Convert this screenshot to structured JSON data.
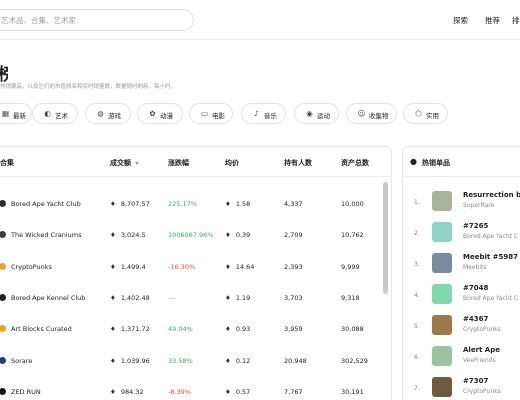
{
  "header": {
    "search_placeholder": "艺术品、合集、艺术家",
    "nav": [
      "探索",
      "推荐"
    ],
    "nav_cut": "排"
  },
  "page": {
    "title": "榜",
    "subtitle": "热销藏品，以及它们的市值排名和实时销量数，数据随时刷新，每小时。"
  },
  "filters": [
    {
      "icon": "grid-icon",
      "glyph": "▦",
      "label": "最新"
    },
    {
      "icon": "palette-icon",
      "glyph": "◐",
      "label": "艺术"
    },
    {
      "icon": "gamepad-icon",
      "glyph": "◍",
      "label": "游戏"
    },
    {
      "icon": "anime-icon",
      "glyph": "✿",
      "label": "动漫"
    },
    {
      "icon": "video-icon",
      "glyph": "▭",
      "label": "电影"
    },
    {
      "icon": "music-icon",
      "glyph": "♪",
      "label": "音乐"
    },
    {
      "icon": "sports-icon",
      "glyph": "◉",
      "label": "运动"
    },
    {
      "icon": "smile-icon",
      "glyph": "☺",
      "label": "收集物"
    },
    {
      "icon": "box-icon",
      "glyph": "⬡",
      "label": "实用"
    }
  ],
  "table": {
    "headers": [
      "合集",
      "成交额",
      "涨跌幅",
      "均价",
      "持有人数",
      "资产总数"
    ],
    "currency_symbol": "♦",
    "rows": [
      {
        "name": "Bored Ape Yacht Club",
        "avatar_color": "#2b2b2b",
        "volume": "8,707.57",
        "change": "225.17%",
        "change_color": "#3cae5d",
        "avg": "1.58",
        "holders": "4,337",
        "assets": "10,000"
      },
      {
        "name": "The Wicked Craniums",
        "avatar_color": "#3a3a3a",
        "volume": "3,024.5",
        "change": "1006067.96%",
        "change_color": "#3cae5d",
        "avg": "0.39",
        "holders": "2,709",
        "assets": "10,762"
      },
      {
        "name": "CryptoPunks",
        "avatar_color": "#e0a43a",
        "volume": "1,499.4",
        "change": "-16.30%",
        "change_color": "#e04f43",
        "avg": "14.64",
        "holders": "2,393",
        "assets": "9,999"
      },
      {
        "name": "Bored Ape Kennel Club",
        "avatar_color": "#222222",
        "volume": "1,402.48",
        "change": "---",
        "change_color": "#999999",
        "avg": "1.19",
        "holders": "3,703",
        "assets": "9,318"
      },
      {
        "name": "Art Blocks Curated",
        "avatar_color": "#f0a020",
        "volume": "1,371.72",
        "change": "49.04%",
        "change_color": "#3cae5d",
        "avg": "0.93",
        "holders": "3,959",
        "assets": "30,088"
      },
      {
        "name": "Sorare",
        "avatar_color": "#2c3b6e",
        "volume": "1,039.96",
        "change": "33.58%",
        "change_color": "#3cae5d",
        "avg": "0.12",
        "holders": "20,948",
        "assets": "302,529"
      },
      {
        "name": "ZED RUN",
        "avatar_color": "#111111",
        "volume": "984.32",
        "change": "-8.39%",
        "change_color": "#e04f43",
        "avg": "0.57",
        "holders": "7,767",
        "assets": "30,191"
      }
    ]
  },
  "hot": {
    "title": "热销单品",
    "items": [
      {
        "rank": "1.",
        "title": "Resurrection by",
        "sub": "SuperRare",
        "color": "#a7b39a"
      },
      {
        "rank": "2.",
        "title": "#7265",
        "sub": "Bored Ape Yacht C",
        "color": "#8fd3c2"
      },
      {
        "rank": "3.",
        "title": "Meebit #5987",
        "sub": "Meebits",
        "color": "#7b8a9c"
      },
      {
        "rank": "4.",
        "title": "#7048",
        "sub": "Bored Ape Yacht C",
        "color": "#7fd8b0"
      },
      {
        "rank": "5.",
        "title": "#4367",
        "sub": "CryptoPunks",
        "color": "#9d7a4e"
      },
      {
        "rank": "6.",
        "title": "Alert Ape",
        "sub": "VeeFriends",
        "color": "#9bc3a0"
      },
      {
        "rank": "7.",
        "title": "#7307",
        "sub": "CryptoPunks",
        "color": "#6f5a3e"
      }
    ]
  }
}
